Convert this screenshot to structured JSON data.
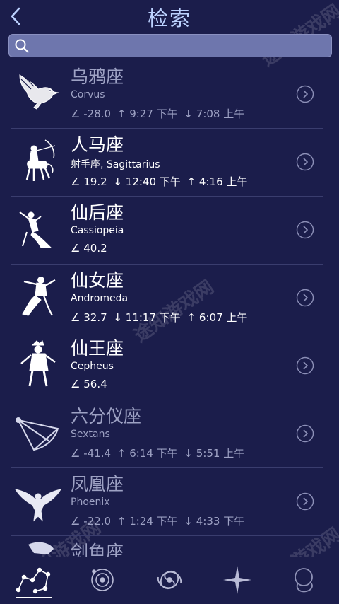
{
  "header": {
    "title": "检索"
  },
  "search": {
    "value": "",
    "placeholder": ""
  },
  "items": [
    {
      "name": "乌鸦座",
      "latin": "Corvus",
      "angle": "-28.0",
      "rise": "9:27 下午",
      "set": "7:08 上午",
      "dim": true,
      "icon": "corvus-crow-icon"
    },
    {
      "name": "人马座",
      "latin": "射手座, Sagittarius",
      "angle": "19.2",
      "set": "12:40 下午",
      "rise": "4:16 上午",
      "dim": false,
      "icon": "sagittarius-archer-icon"
    },
    {
      "name": "仙后座",
      "latin": "Cassiopeia",
      "angle": "40.2",
      "dim": false,
      "icon": "cassiopeia-queen-icon"
    },
    {
      "name": "仙女座",
      "latin": "Andromeda",
      "angle": "32.7",
      "set": "11:17 下午",
      "rise": "6:07 上午",
      "dim": false,
      "icon": "andromeda-maiden-icon"
    },
    {
      "name": "仙王座",
      "latin": "Cepheus",
      "angle": "56.4",
      "dim": false,
      "icon": "cepheus-king-icon"
    },
    {
      "name": "六分仪座",
      "latin": "Sextans",
      "angle": "-41.4",
      "rise": "6:14 下午",
      "set": "5:51 上午",
      "dim": true,
      "icon": "sextans-sextant-icon"
    },
    {
      "name": "凤凰座",
      "latin": "Phoenix",
      "angle": "-22.0",
      "rise": "1:24 下午",
      "set": "4:33 下午",
      "dim": true,
      "icon": "phoenix-bird-icon"
    },
    {
      "name": "剑鱼座",
      "dim": true,
      "icon": "dorado-fish-icon"
    }
  ],
  "tabs": [
    "constellations-tab-icon",
    "planets-tab-icon",
    "galaxy-tab-icon",
    "stars-tab-icon",
    "more-tab-icon"
  ],
  "watermark": "途知游戏网",
  "colors": {
    "background": "#1b1d4b",
    "title": "#bcd2ff",
    "search": "#6e76ad",
    "dim_text": "#9ea2c4"
  }
}
